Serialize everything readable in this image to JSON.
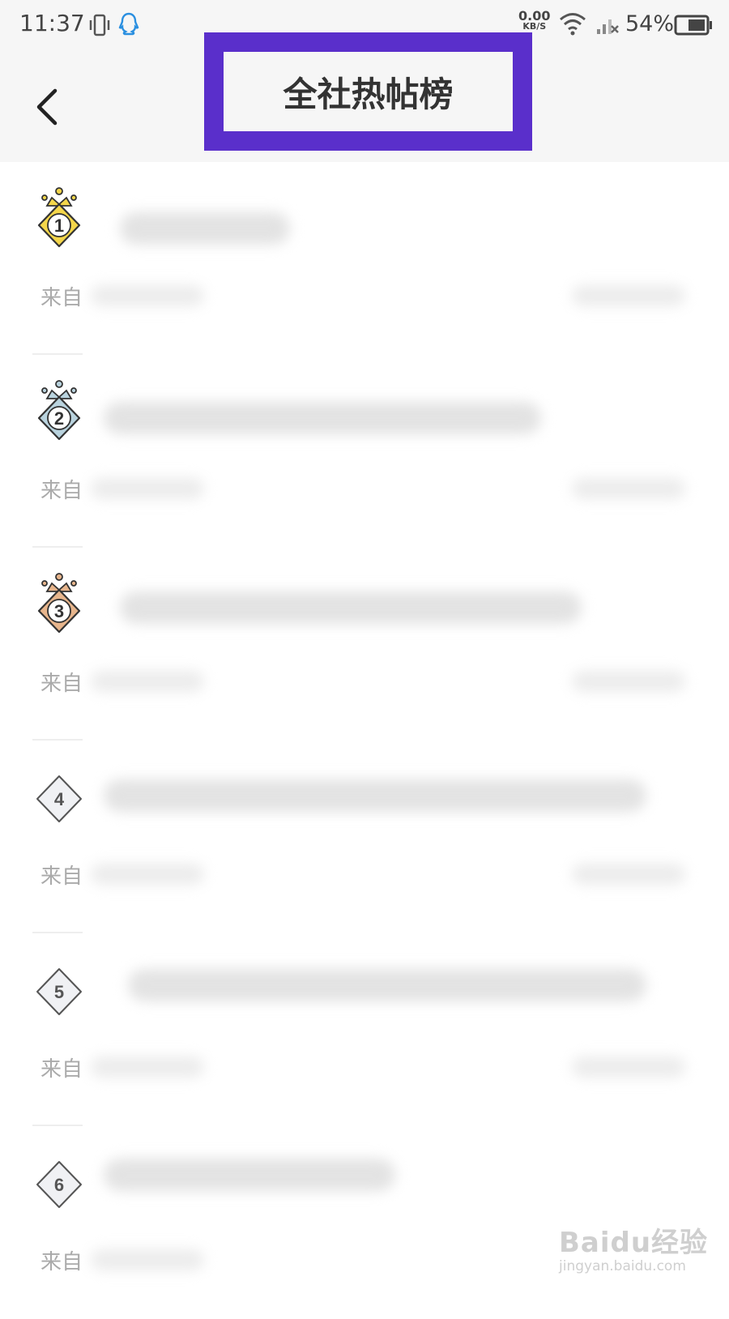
{
  "status_bar": {
    "time": "11:37",
    "net_speed": "0.00",
    "net_unit": "KB/S",
    "battery": "54%"
  },
  "header": {
    "title": "全社热帖榜"
  },
  "list": {
    "rows": [
      {
        "rank": "1",
        "from_label": "来自"
      },
      {
        "rank": "2",
        "from_label": "来自"
      },
      {
        "rank": "3",
        "from_label": "来自"
      },
      {
        "rank": "4",
        "from_label": "来自"
      },
      {
        "rank": "5",
        "from_label": "来自"
      },
      {
        "rank": "6",
        "from_label": "来自"
      }
    ]
  },
  "watermark": {
    "brand": "Baidu经验",
    "url": "jingyan.baidu.com"
  },
  "colors": {
    "highlight": "#5a2fcb",
    "gold": "#f4d64a",
    "silver": "#b9d3de",
    "bronze": "#e7b58c"
  }
}
